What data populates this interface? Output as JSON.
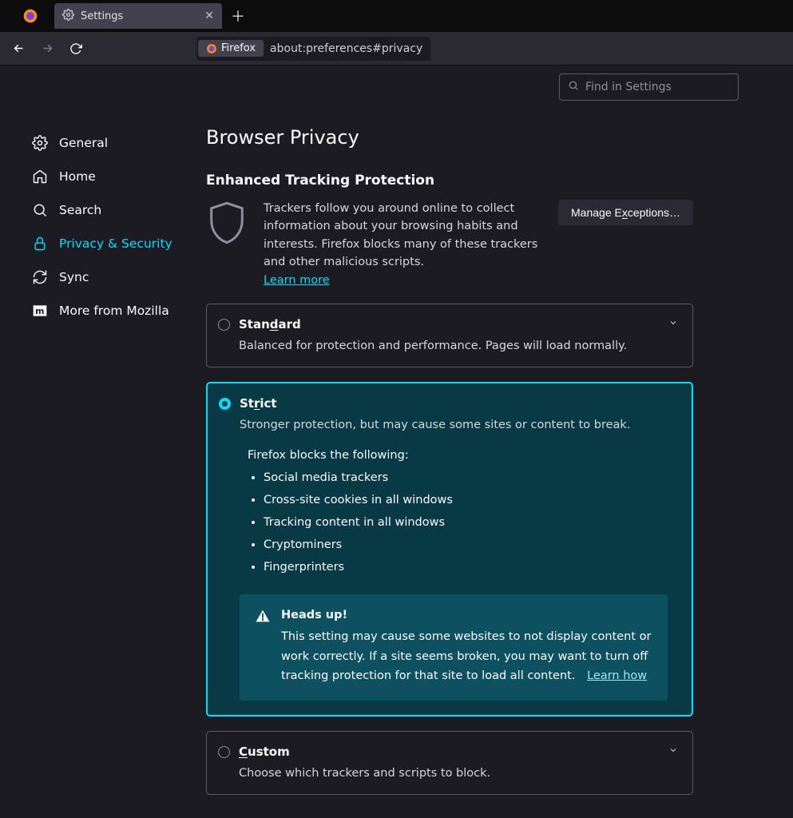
{
  "tab": {
    "title": "Settings"
  },
  "url": {
    "pill": "Firefox",
    "path": "about:preferences#privacy"
  },
  "search": {
    "placeholder": "Find in Settings"
  },
  "sidebar": {
    "items": [
      {
        "label": "General"
      },
      {
        "label": "Home"
      },
      {
        "label": "Search"
      },
      {
        "label": "Privacy & Security"
      },
      {
        "label": "Sync"
      },
      {
        "label": "More from Mozilla"
      }
    ]
  },
  "main": {
    "title": "Browser Privacy",
    "section": "Enhanced Tracking Protection",
    "etp_text": "Trackers follow you around online to collect information about your browsing habits and interests. Firefox blocks many of these trackers and other malicious scripts.",
    "learn_more": "Learn more",
    "manage": "Manage Exceptions…",
    "cards": {
      "standard": {
        "title_pre": "Stan",
        "title_u": "d",
        "title_post": "ard",
        "desc": "Balanced for protection and performance. Pages will load normally."
      },
      "strict": {
        "title_pre": "St",
        "title_u": "r",
        "title_post": "ict",
        "desc": "Stronger protection, but may cause some sites or content to break.",
        "blocks_intro": "Firefox blocks the following:",
        "blocks": [
          "Social media trackers",
          "Cross-site cookies in all windows",
          "Tracking content in all windows",
          "Cryptominers",
          "Fingerprinters"
        ],
        "headsup_title": "Heads up!",
        "headsup_body": "This setting may cause some websites to not display content or work correctly. If a site seems broken, you may want to turn off tracking protection for that site to load all content.",
        "headsup_link": "Learn how"
      },
      "custom": {
        "title_u": "C",
        "title_post": "ustom",
        "desc": "Choose which trackers and scripts to block."
      }
    }
  }
}
